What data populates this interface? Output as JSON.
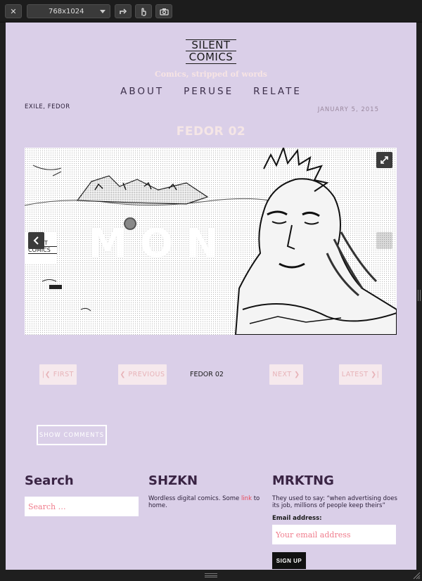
{
  "toolbar": {
    "close_label": "✕",
    "size_label": "768x1024"
  },
  "site": {
    "logo_line1": "SILENT",
    "logo_line2": "COMICS",
    "tagline": "Comics, stripped of words",
    "nav": [
      {
        "label": "ABOUT"
      },
      {
        "label": "PERUSE"
      },
      {
        "label": "RELATE"
      }
    ]
  },
  "post": {
    "categories": "EXILE, FEDOR",
    "date": "JANUARY 5, 2015",
    "title": "FEDOR 02",
    "comic_text": "MON",
    "comic_logo_line1": "SILENT",
    "comic_logo_line2": "COMICS"
  },
  "pager": {
    "first": "|❮ FIRST",
    "previous": "❮ PREVIOUS",
    "current": "FEDOR 02",
    "next": "NEXT ❯",
    "latest": "LATEST ❯|"
  },
  "comments": {
    "show_label": "SHOW COMMENTS"
  },
  "widgets": {
    "search": {
      "title": "Search",
      "placeholder": "Search …"
    },
    "shzkn": {
      "title": "SHZKN",
      "text_before": "Wordless digital comics. Some ",
      "link": "link",
      "text_after": " to home."
    },
    "mrktng": {
      "title": "MRKTNG",
      "text": "They used to say: “when advertising does its job, millions of people keep theirs”",
      "email_label": "Email address:",
      "email_placeholder": "Your email address",
      "signup_label": "SIGN UP"
    }
  },
  "colors": {
    "page_bg": "#dacfe8",
    "accent_pink": "#f07c8c",
    "link_red": "#e8485a",
    "heading_purple": "#3a2444"
  }
}
